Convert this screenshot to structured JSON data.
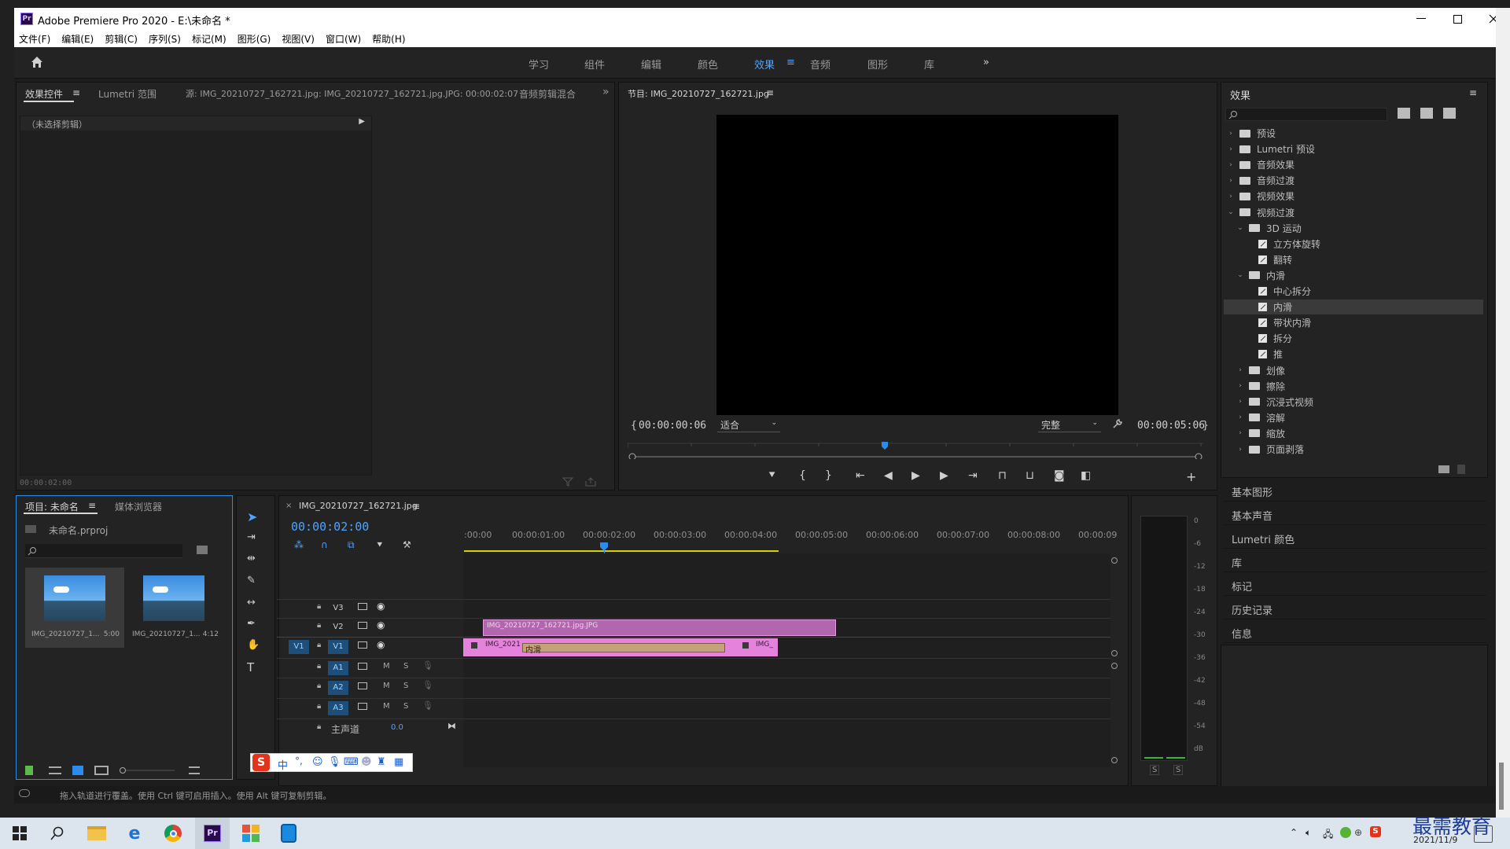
{
  "window": {
    "title": "Adobe Premiere Pro 2020 - E:\\未命名 *",
    "logo": "Pr"
  },
  "menu": [
    "文件(F)",
    "编辑(E)",
    "剪辑(C)",
    "序列(S)",
    "标记(M)",
    "图形(G)",
    "视图(V)",
    "窗口(W)",
    "帮助(H)"
  ],
  "workspaces": [
    "学习",
    "组件",
    "编辑",
    "颜色",
    "效果",
    "音频",
    "图形",
    "库"
  ],
  "active_workspace": "效果",
  "source_panel": {
    "tabs": [
      "效果控件",
      "Lumetri 范围",
      "源: IMG_20210727_162721.jpg: IMG_20210727_162721.jpg.JPG: 00:00:02:07",
      "音频剪辑混合"
    ],
    "no_clip": "（未选择剪辑）",
    "timecode": "00:00:02:00"
  },
  "program": {
    "title": "节目: IMG_20210727_162721.jpg",
    "timecode_left": "00:00:00:06",
    "fit": "适合",
    "quality": "完整",
    "timecode_right": "00:00:05:06"
  },
  "effects": {
    "title": "效果",
    "items": [
      {
        "label": "预设",
        "level": 0,
        "type": "folder",
        "open": false
      },
      {
        "label": "Lumetri 预设",
        "level": 0,
        "type": "folder",
        "open": false
      },
      {
        "label": "音频效果",
        "level": 0,
        "type": "folder",
        "open": false
      },
      {
        "label": "音频过渡",
        "level": 0,
        "type": "folder",
        "open": false
      },
      {
        "label": "视频效果",
        "level": 0,
        "type": "folder",
        "open": false
      },
      {
        "label": "视频过渡",
        "level": 0,
        "type": "folder",
        "open": true
      },
      {
        "label": "3D 运动",
        "level": 1,
        "type": "folder",
        "open": true
      },
      {
        "label": "立方体旋转",
        "level": 2,
        "type": "fx"
      },
      {
        "label": "翻转",
        "level": 2,
        "type": "fx"
      },
      {
        "label": "内滑",
        "level": 1,
        "type": "folder",
        "open": true
      },
      {
        "label": "中心拆分",
        "level": 2,
        "type": "fx"
      },
      {
        "label": "内滑",
        "level": 2,
        "type": "fx",
        "selected": true
      },
      {
        "label": "带状内滑",
        "level": 2,
        "type": "fx"
      },
      {
        "label": "拆分",
        "level": 2,
        "type": "fx"
      },
      {
        "label": "推",
        "level": 2,
        "type": "fx"
      },
      {
        "label": "划像",
        "level": 1,
        "type": "folder",
        "open": false
      },
      {
        "label": "擦除",
        "level": 1,
        "type": "folder",
        "open": false
      },
      {
        "label": "沉浸式视频",
        "level": 1,
        "type": "folder",
        "open": false
      },
      {
        "label": "溶解",
        "level": 1,
        "type": "folder",
        "open": false
      },
      {
        "label": "缩放",
        "level": 1,
        "type": "folder",
        "open": false
      },
      {
        "label": "页面剥落",
        "level": 1,
        "type": "folder",
        "open": false
      }
    ]
  },
  "side_panels": [
    "基本图形",
    "基本声音",
    "Lumetri 颜色",
    "库",
    "标记",
    "历史记录",
    "信息"
  ],
  "project": {
    "tabs": [
      "项目: 未命名",
      "媒体浏览器"
    ],
    "file": "未命名.prproj",
    "items": [
      {
        "name": "IMG_20210727_1...",
        "duration": "5:00"
      },
      {
        "name": "IMG_20210727_1...",
        "duration": "4:12"
      }
    ]
  },
  "timeline": {
    "tab": "IMG_20210727_162721.jpg",
    "timecode": "00:00:02:00",
    "ruler": [
      ":00:00",
      "00:00:01:00",
      "00:00:02:00",
      "00:00:03:00",
      "00:00:04:00",
      "00:00:05:00",
      "00:00:06:00",
      "00:00:07:00",
      "00:00:08:00",
      "00:00:09"
    ],
    "tracks_video": [
      "V3",
      "V2",
      "V1"
    ],
    "tracks_audio": [
      "A1",
      "A2",
      "A3"
    ],
    "source_patch": "V1",
    "master": {
      "label": "主声道",
      "value": "0.0"
    },
    "clip_v2": "IMG_20210727_162721.jpg.JPG",
    "clip_v1a": "IMG_2021",
    "transition": "内滑",
    "clip_v1b": "IMG_",
    "mute": "M",
    "solo": "S"
  },
  "meter": {
    "labels": [
      "0",
      "-6",
      "-12",
      "-18",
      "-24",
      "-30",
      "-36",
      "-42",
      "-48",
      "-54",
      "dB"
    ],
    "solo": [
      "S",
      "S"
    ]
  },
  "status": "拖入轨道进行覆盖。使用 Ctrl 键可启用插入。使用 Alt 键可复制剪辑。",
  "ime": {
    "labels": [
      "中",
      "°,"
    ]
  },
  "taskbar": {
    "date": "2021/11/9"
  },
  "watermark": "最需教育",
  "colors": {
    "accent": "#2d8ceb",
    "clip": "#c36fbd",
    "clip_light": "#e07fd8",
    "transition": "#c4a27c",
    "bg": "#232323"
  }
}
